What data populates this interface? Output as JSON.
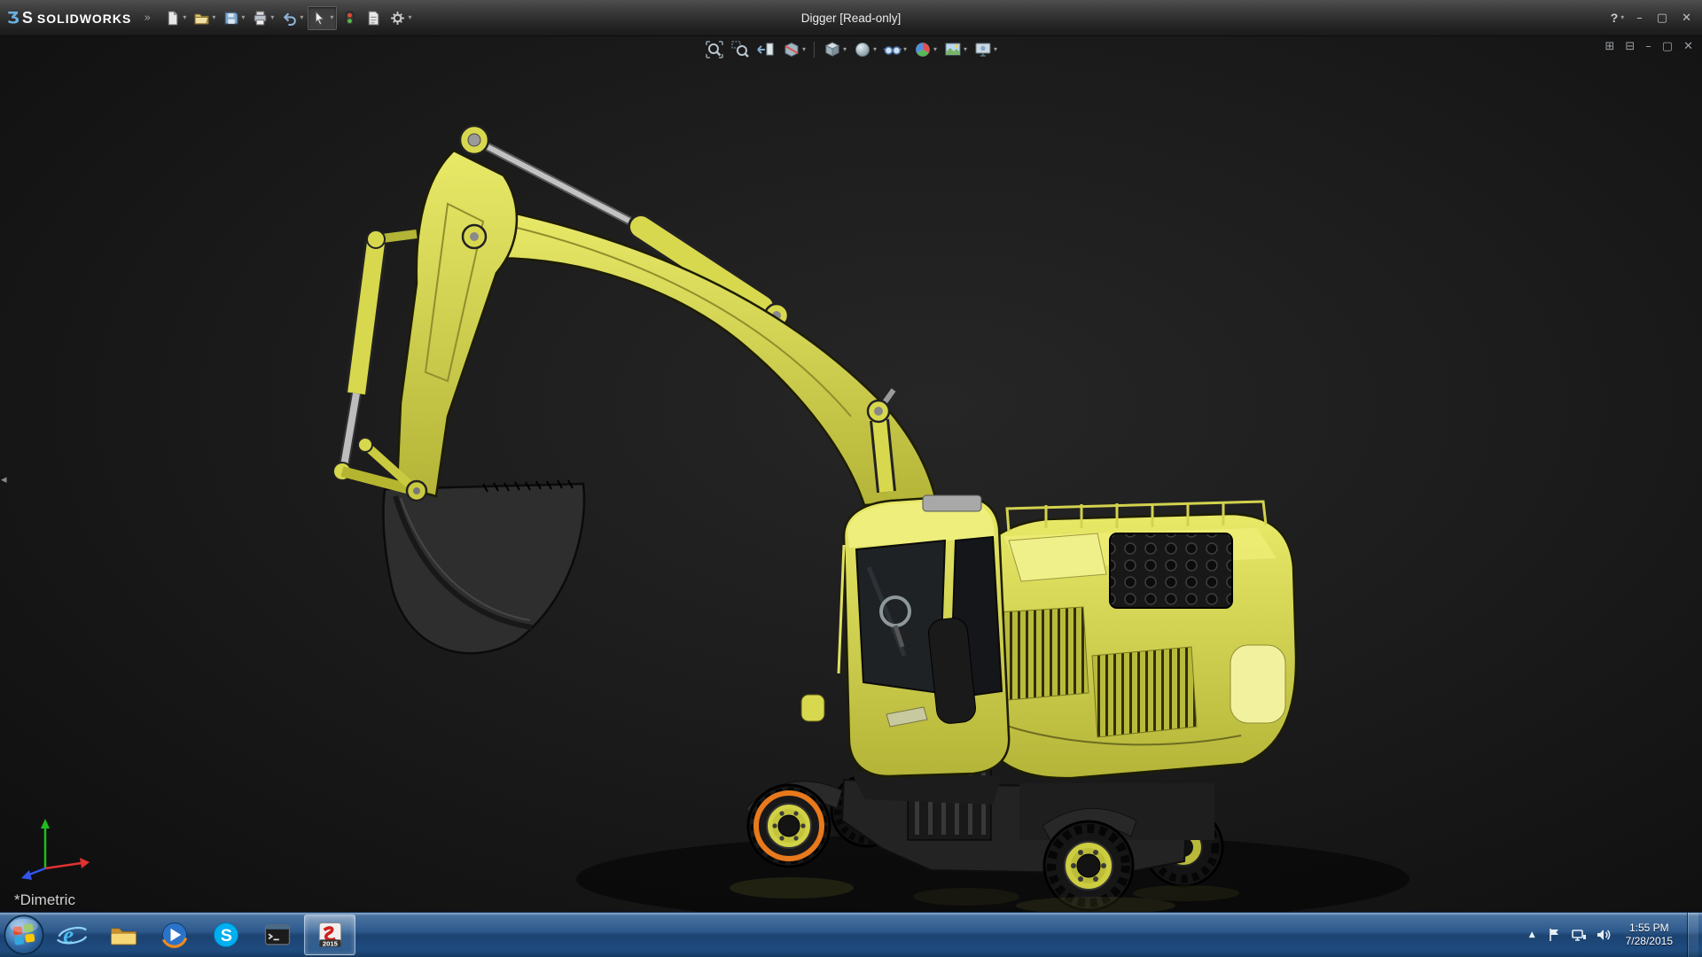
{
  "titlebar": {
    "logo_mark_left": "Ʒ",
    "logo_mark_right": "S",
    "logo_text": "SOLIDWORKS",
    "logo_chevron": "»",
    "title": "Digger [Read-only]",
    "help_label": "?",
    "window_controls": {
      "minimize": "–",
      "maximize": "▢",
      "close": "✕"
    },
    "tools": [
      "new",
      "open",
      "save",
      "print",
      "undo",
      "select",
      "rebuild",
      "file-properties",
      "options"
    ]
  },
  "glyphs": {
    "chevron_down": "▾",
    "collapse": "◂",
    "tray_arrow": "▲"
  },
  "viewport": {
    "orientation_label": "*Dimetric",
    "headsup_tools": [
      "zoom-to-fit",
      "zoom-to-area",
      "previous-view",
      "section-view",
      "view-orientation",
      "display-style",
      "hide-show-items",
      "edit-appearance",
      "apply-scene",
      "view-settings"
    ],
    "document_controls": {
      "cascade": "⊞",
      "tile": "⊟",
      "minimize": "–",
      "restore": "▢",
      "close": "✕"
    },
    "model": {
      "name": "Digger excavator assembly",
      "body_color": "#d8d84e",
      "selection_color": "#e8791c",
      "selected_component": "front wheel"
    }
  },
  "taskbar": {
    "items": [
      "start",
      "internet-explorer",
      "windows-explorer",
      "media-player",
      "skype",
      "command-prompt",
      "solidworks"
    ],
    "ie_letter": "e",
    "skype_letter": "S",
    "solidworks_year": "2015",
    "tray": {
      "time": "1:55 PM",
      "date": "7/28/2015"
    }
  }
}
